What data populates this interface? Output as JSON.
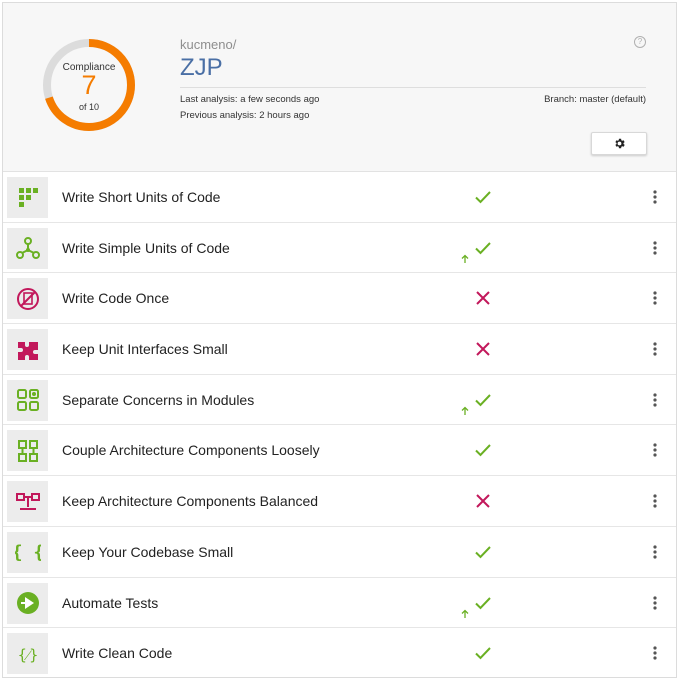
{
  "compliance": {
    "label": "Compliance",
    "value": "7",
    "of": "of 10",
    "fraction": 0.7,
    "color": "#f57c00"
  },
  "project": {
    "org": "kucmeno/",
    "name": "ZJP"
  },
  "analysis": {
    "last": "Last analysis: a few seconds ago",
    "previous": "Previous analysis: 2 hours ago",
    "branch": "Branch: master (default)"
  },
  "colors": {
    "pass": "#6ab023",
    "fail": "#c2185b",
    "accent": "#4a6fa5"
  },
  "guidelines": [
    {
      "label": "Write Short Units of Code",
      "status": "pass",
      "trend": false,
      "icon": "grid-dots-icon"
    },
    {
      "label": "Write Simple Units of Code",
      "status": "pass",
      "trend": true,
      "icon": "branch-nodes-icon"
    },
    {
      "label": "Write Code Once",
      "status": "fail",
      "trend": false,
      "icon": "no-copy-icon"
    },
    {
      "label": "Keep Unit Interfaces Small",
      "status": "fail",
      "trend": false,
      "icon": "puzzle-icon"
    },
    {
      "label": "Separate Concerns in Modules",
      "status": "pass",
      "trend": true,
      "icon": "modules-grid-icon"
    },
    {
      "label": "Couple Architecture Components Loosely",
      "status": "pass",
      "trend": false,
      "icon": "components-grid-icon"
    },
    {
      "label": "Keep Architecture Components Balanced",
      "status": "fail",
      "trend": false,
      "icon": "balance-icon"
    },
    {
      "label": "Keep Your Codebase Small",
      "status": "pass",
      "trend": false,
      "icon": "braces-icon"
    },
    {
      "label": "Automate Tests",
      "status": "pass",
      "trend": true,
      "icon": "play-circle-icon"
    },
    {
      "label": "Write Clean Code",
      "status": "pass",
      "trend": false,
      "icon": "broom-braces-icon"
    }
  ]
}
